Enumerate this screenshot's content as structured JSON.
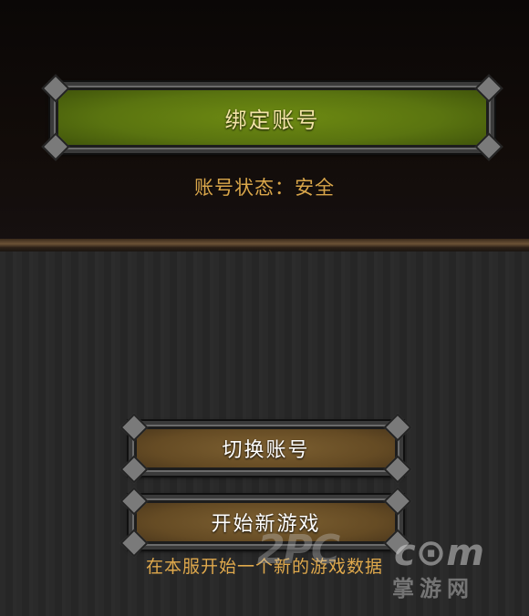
{
  "account": {
    "bind_label": "绑定账号",
    "status_text": "账号状态：安全"
  },
  "actions": {
    "switch_label": "切换账号",
    "new_game_label": "开始新游戏",
    "new_game_hint": "在本服开始一个新的游戏数据"
  },
  "watermark": {
    "mark": "2PC",
    "com": "c⊙m",
    "site_cn": "掌游网"
  },
  "colors": {
    "bind_button": "#5a7410",
    "action_button": "#654b24",
    "accent_text": "#d9a64a"
  }
}
